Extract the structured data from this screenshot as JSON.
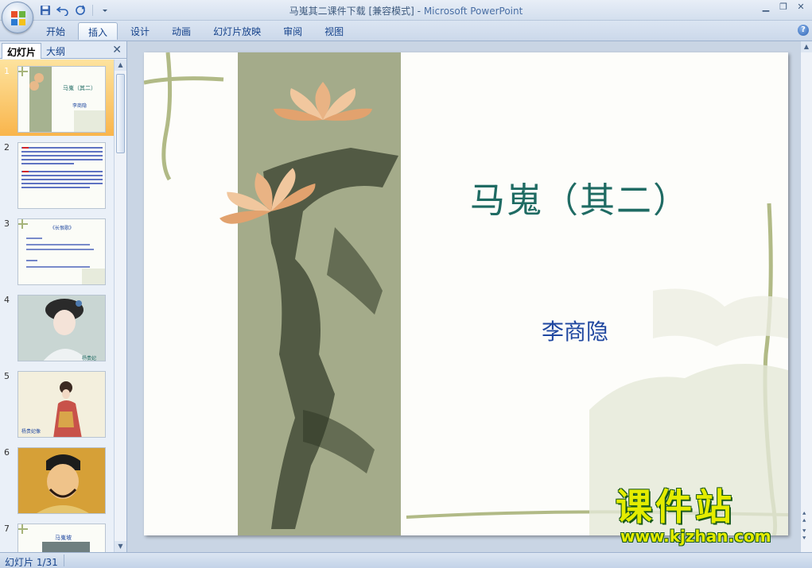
{
  "window": {
    "title": "马嵬其二课件下载 [兼容模式] - ",
    "app_name": "Microsoft PowerPoint"
  },
  "ribbon": {
    "tabs": [
      "开始",
      "插入",
      "设计",
      "动画",
      "幻灯片放映",
      "审阅",
      "视图"
    ],
    "active_tab": "插入"
  },
  "left_pane": {
    "tabs": [
      "幻灯片",
      "大纲"
    ],
    "active_tab": "幻灯片",
    "thumbnails": [
      {
        "number": "1",
        "title": "马嵬（其二）",
        "sub": "李商隐",
        "selected": true
      },
      {
        "number": "2"
      },
      {
        "number": "3",
        "title": "《长恨歌》"
      },
      {
        "number": "4",
        "caption": "杨贵妃"
      },
      {
        "number": "5",
        "caption": "杨贵妃像"
      },
      {
        "number": "6"
      },
      {
        "number": "7",
        "title": "马嵬坡"
      }
    ]
  },
  "slide": {
    "title": "马嵬（其二）",
    "author": "李商隐"
  },
  "watermark": {
    "text": "课件站",
    "url": "www.kjzhan.com"
  },
  "status": {
    "slide_indicator": "幻灯片 1/31"
  },
  "colors": {
    "title_color": "#1f6b63",
    "author_color": "#1f47a0",
    "selected_thumb": "#f9b54c",
    "watermark": "#e4ec00"
  }
}
